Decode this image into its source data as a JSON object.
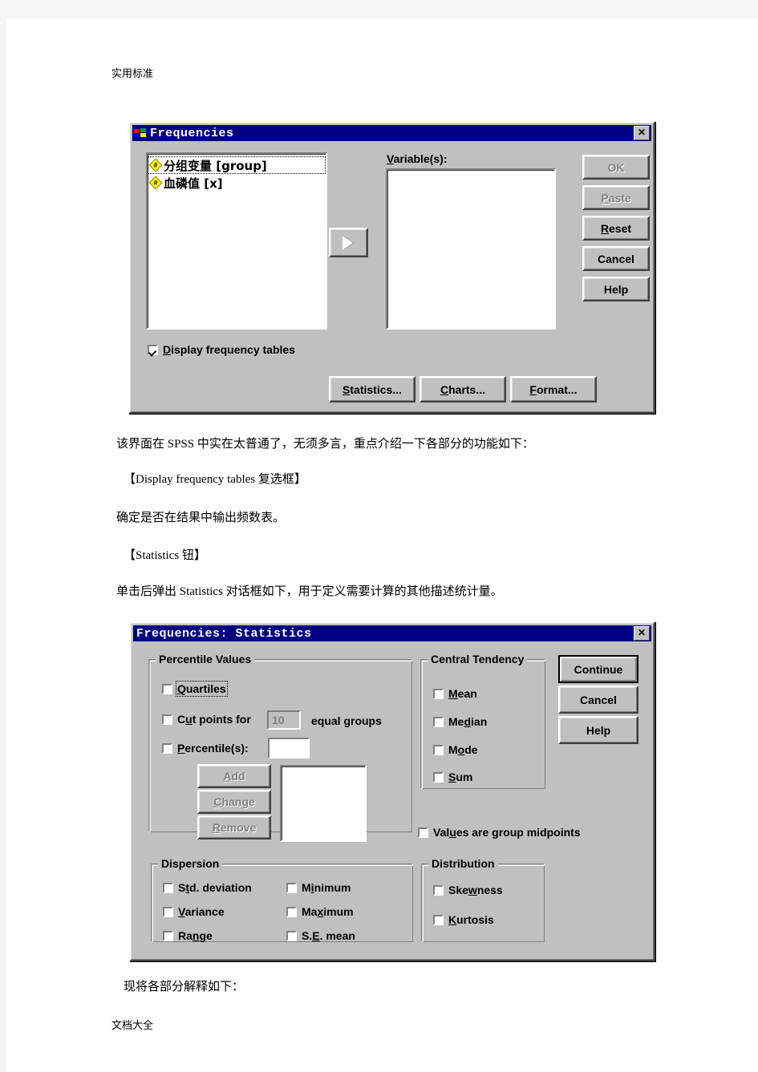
{
  "document": {
    "header_text": "实用标准",
    "footer_text": "文档大全",
    "paragraphs": [
      "该界面在 SPSS 中实在太普通了，无须多言，重点介绍一下各部分的功能如下：",
      "【Display frequency tables 复选框】",
      "确定是否在结果中输出频数表。",
      "【Statistics 钮】",
      "单击后弹出 Statistics 对话框如下，用于定义需要计算的其他描述统计量。",
      "现将各部分解释如下："
    ]
  },
  "frequencies_dialog": {
    "title": "Frequencies",
    "title_icon": "spss-flag-icon",
    "close_label": "✕",
    "source_list": {
      "items": [
        {
          "label": "分组变量 [group]",
          "icon": "scale-variable-icon",
          "selected": true
        },
        {
          "label": "血磷值 [x]",
          "icon": "scale-variable-icon",
          "selected": false
        }
      ]
    },
    "move_button_label": "▶",
    "variables_label": "Variable(s):",
    "variables_list": {
      "items": []
    },
    "display_frequency_tables": {
      "label": "Display frequency tables",
      "checked": true,
      "underline_char": "D"
    },
    "buttons": [
      {
        "label": "OK",
        "disabled": true,
        "default": false
      },
      {
        "label": "Paste",
        "disabled": true,
        "default": false
      },
      {
        "label": "Reset",
        "disabled": false,
        "default": false
      },
      {
        "label": "Cancel",
        "disabled": false,
        "default": false
      },
      {
        "label": "Help",
        "disabled": false,
        "default": false
      }
    ],
    "bottom_buttons": [
      {
        "label": "Statistics..."
      },
      {
        "label": "Charts..."
      },
      {
        "label": "Format..."
      }
    ]
  },
  "statistics_dialog": {
    "title": "Frequencies: Statistics",
    "close_label": "✕",
    "percentile_values": {
      "group_label": "Percentile Values",
      "quartiles": {
        "label": "Quartiles",
        "checked": false,
        "focused": true
      },
      "cut_points": {
        "label_before": "Cut points for",
        "value": "10",
        "label_after": "equal groups",
        "checked": false
      },
      "percentiles": {
        "label": "Percentile(s):",
        "value": "",
        "checked": false
      },
      "buttons": [
        {
          "label": "Add",
          "disabled": true
        },
        {
          "label": "Change",
          "disabled": true
        },
        {
          "label": "Remove",
          "disabled": true
        }
      ],
      "list_items": []
    },
    "central_tendency": {
      "group_label": "Central Tendency",
      "items": [
        {
          "label": "Mean",
          "checked": false
        },
        {
          "label": "Median",
          "checked": false
        },
        {
          "label": "Mode",
          "checked": false
        },
        {
          "label": "Sum",
          "checked": false
        }
      ]
    },
    "values_are_group_midpoints": {
      "label": "Values are group midpoints",
      "checked": false
    },
    "dispersion": {
      "group_label": "Dispersion",
      "col1": [
        {
          "label": "Std. deviation",
          "checked": false
        },
        {
          "label": "Variance",
          "checked": false
        },
        {
          "label": "Range",
          "checked": false
        }
      ],
      "col2": [
        {
          "label": "Minimum",
          "checked": false
        },
        {
          "label": "Maximum",
          "checked": false
        },
        {
          "label": "S.E. mean",
          "checked": false
        }
      ]
    },
    "distribution": {
      "group_label": "Distribution",
      "items": [
        {
          "label": "Skewness",
          "checked": false
        },
        {
          "label": "Kurtosis",
          "checked": false
        }
      ]
    },
    "buttons": [
      {
        "label": "Continue",
        "default": true
      },
      {
        "label": "Cancel",
        "default": false
      },
      {
        "label": "Help",
        "default": false
      }
    ]
  },
  "colors": {
    "title_bar": "#000080",
    "dialog_face": "#c0c0c0",
    "page_background": "#ffffff",
    "margin_background": "#f5f5f5"
  }
}
